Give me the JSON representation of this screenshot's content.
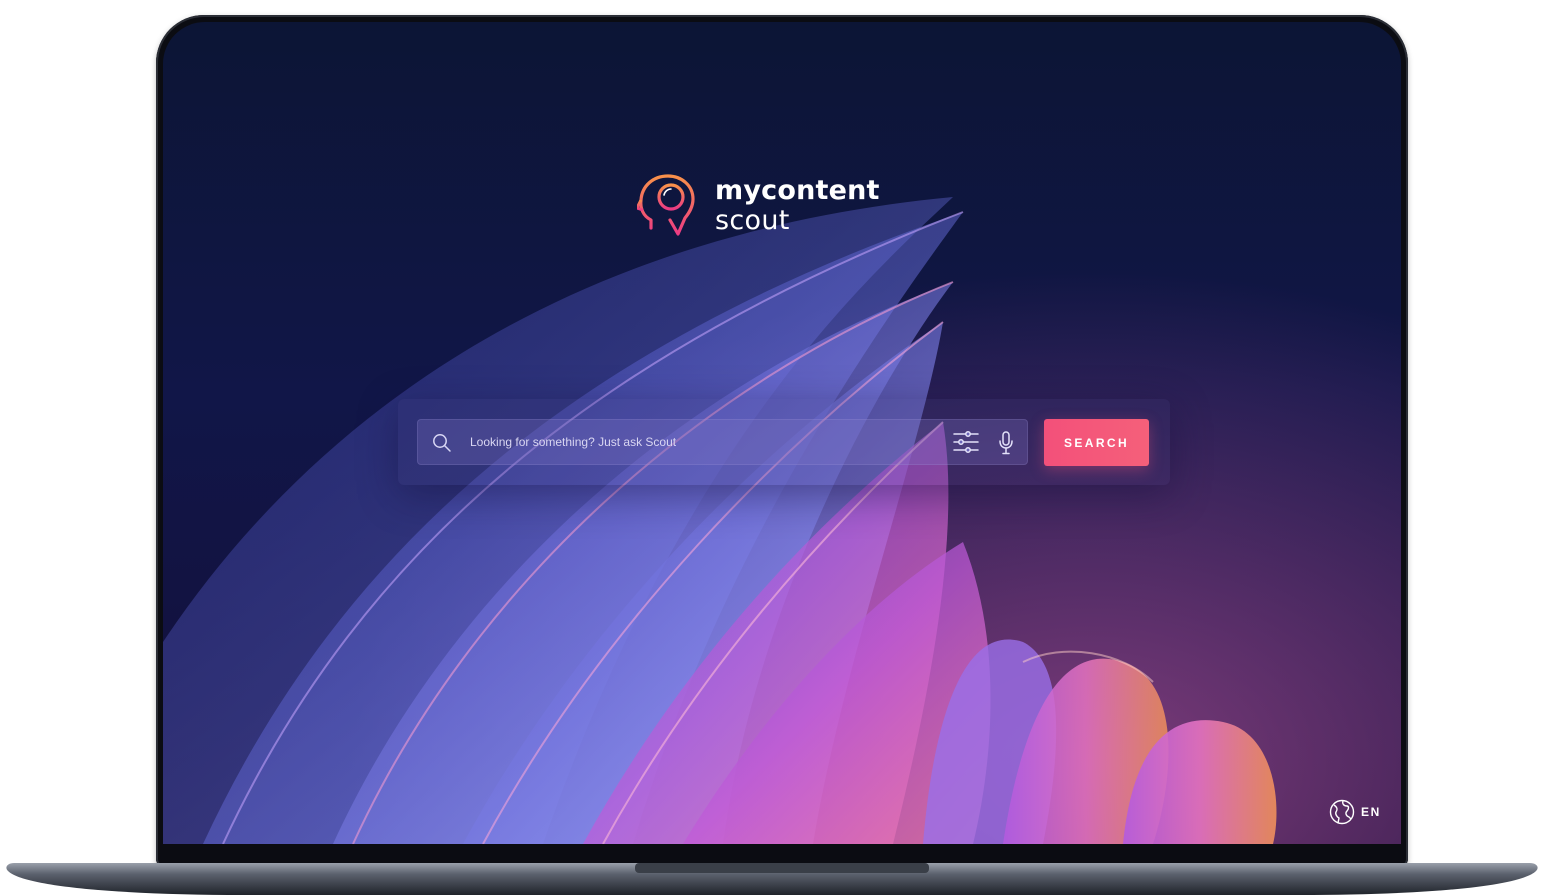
{
  "brand": {
    "name_line1": "mycontent",
    "name_line2": "scout"
  },
  "search": {
    "placeholder": "Looking for something? Just ask Scout",
    "value": "",
    "button_label": "SEARCH",
    "search_icon": "search-icon",
    "filter_icon": "filter-sliders-icon",
    "mic_icon": "microphone-icon"
  },
  "language": {
    "label": "EN",
    "icon": "globe-icon"
  },
  "colors": {
    "background": "#111648",
    "accent": "#f3507a",
    "logo_gradient_start": "#f8914a",
    "logo_gradient_end": "#ec3b83"
  }
}
